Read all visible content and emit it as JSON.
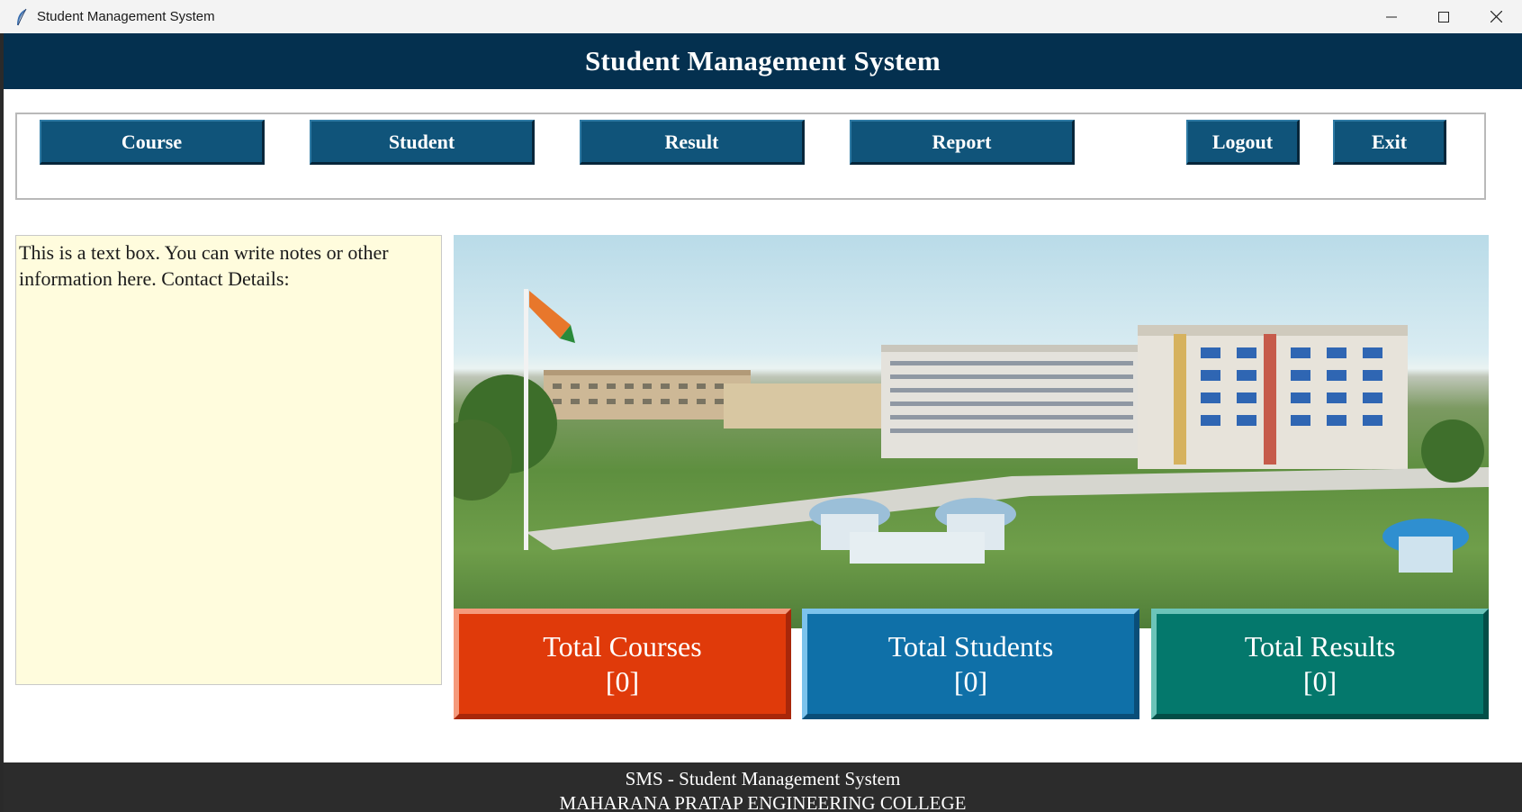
{
  "window": {
    "title": "Student Management System",
    "icon": "feather-icon",
    "controls": [
      "minimize-icon",
      "maximize-icon",
      "close-icon"
    ]
  },
  "header": {
    "title": "Student Management System"
  },
  "menu": {
    "course": "Course",
    "student": "Student",
    "result": "Result",
    "report": "Report",
    "logout": "Logout",
    "exit": "Exit"
  },
  "notes": {
    "text": "This is a text box. You can write notes or other information here. Contact Details:"
  },
  "stats": {
    "courses_label": "Total Courses",
    "courses_value": "[0]",
    "students_label": "Total Students",
    "students_value": "[0]",
    "results_label": "Total Results",
    "results_value": "[0]"
  },
  "footer": {
    "line1": "SMS - Student Management System",
    "line2": "MAHARANA PRATAP ENGINEERING COLLEGE"
  },
  "colors": {
    "header_bg": "#04304f",
    "button_bg": "#10547a",
    "courses_bg": "#e03a0a",
    "students_bg": "#0f70a8",
    "results_bg": "#04786c",
    "footer_bg": "#2c2c2c",
    "notes_bg": "#fffcdd"
  }
}
